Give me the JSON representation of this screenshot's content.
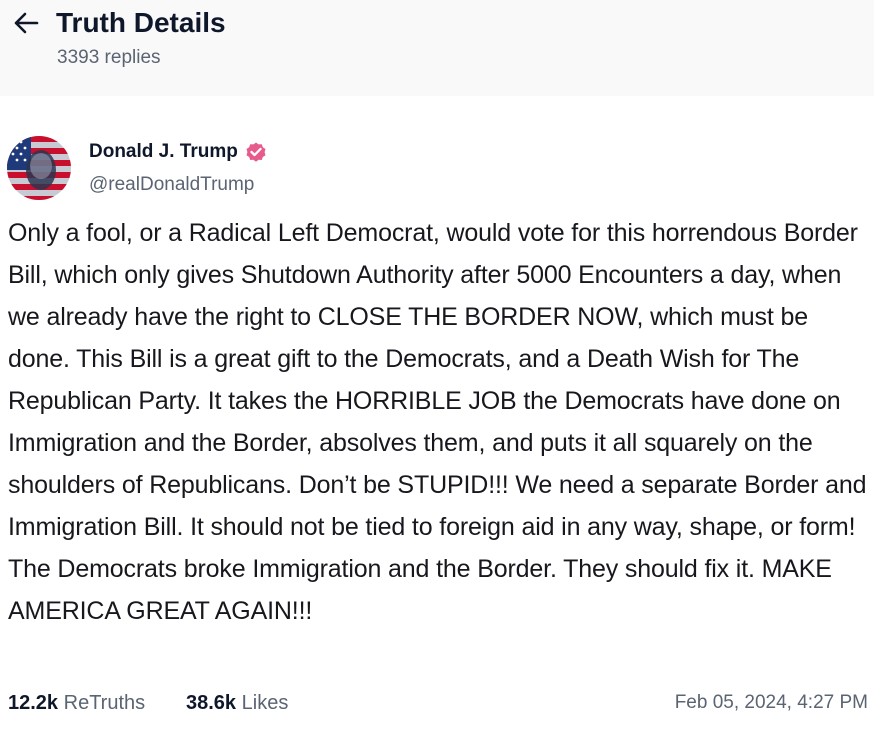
{
  "header": {
    "title": "Truth Details",
    "replies": "3393 replies"
  },
  "author": {
    "name": "Donald J. Trump",
    "handle": "@realDonaldTrump",
    "verified_color": "#e75a8d"
  },
  "post": {
    "text": "Only a fool, or a Radical Left Democrat, would vote for this horrendous Border Bill, which only gives Shutdown Authority after 5000 Encounters a day, when we already have the right to CLOSE THE BORDER NOW, which must be done. This Bill is a great gift to the Democrats, and a Death Wish for The Republican Party. It takes the HORRIBLE JOB the Democrats have done on Immigration and the Border, absolves them, and puts it all squarely on the shoulders of Republicans. Don’t be STUPID!!! We need a separate Border and Immigration Bill. It should not be tied to foreign aid in any way, shape, or form! The Democrats broke Immigration and the Border. They should fix it. MAKE AMERICA GREAT AGAIN!!!"
  },
  "stats": {
    "retruths_count": "12.2k",
    "retruths_label": "ReTruths",
    "likes_count": "38.6k",
    "likes_label": "Likes"
  },
  "timestamp": "Feb 05, 2024, 4:27 PM",
  "icons": {
    "back": "arrow-left-icon",
    "verified": "verified-badge-icon"
  }
}
